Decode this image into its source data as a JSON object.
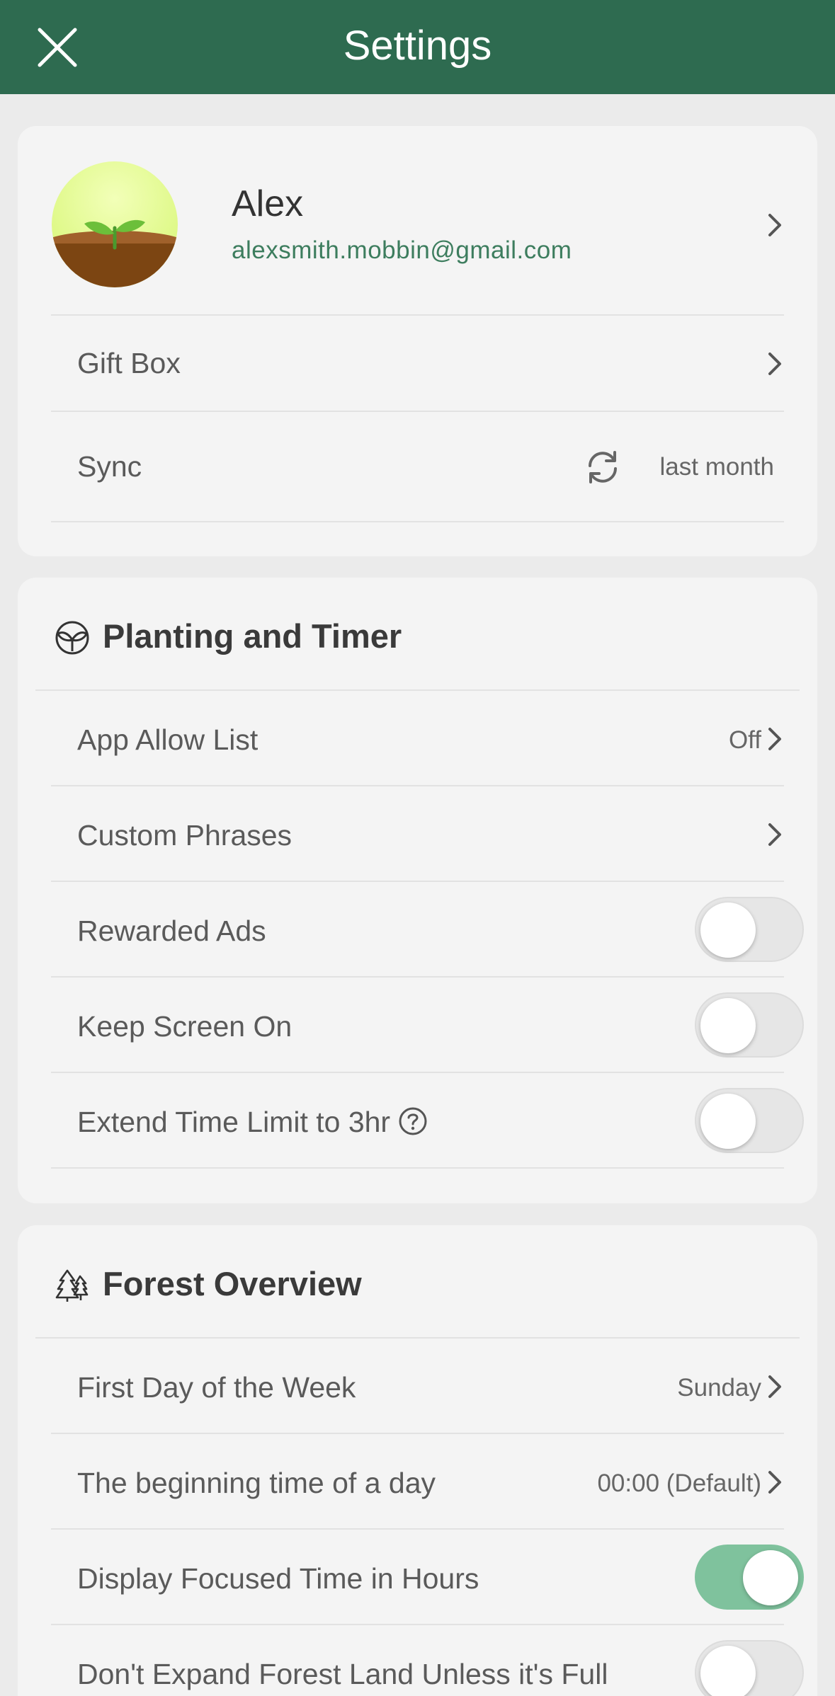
{
  "header": {
    "title": "Settings",
    "background": "#2e6b50"
  },
  "profile": {
    "name": "Alex",
    "email": "alexsmith.mobbin@gmail.com",
    "avatar_icon": "sprout-icon"
  },
  "account_rows": [
    {
      "label": "Gift Box"
    },
    {
      "label": "Sync",
      "value": "last month"
    }
  ],
  "planting": {
    "title": "Planting and Timer",
    "rows": [
      {
        "label": "App Allow List",
        "value": "Off"
      },
      {
        "label": "Custom Phrases"
      },
      {
        "label": "Rewarded Ads",
        "toggle": false
      },
      {
        "label": "Keep Screen On",
        "toggle": false
      },
      {
        "label": "Extend Time Limit to 3hr",
        "toggle": false
      }
    ]
  },
  "forest": {
    "title": "Forest Overview",
    "rows": [
      {
        "label": "First Day of the Week",
        "value": "Sunday"
      },
      {
        "label": "The beginning time of a day",
        "value": "00:00 (Default)"
      },
      {
        "label": "Display Focused Time in Hours",
        "toggle": true
      },
      {
        "label": "Don't Expand Forest Land Unless it's Full",
        "toggle": false
      }
    ]
  },
  "colors": {
    "accent": "#2e6b50",
    "email": "#3d7d5e",
    "toggle_on": "#7fc29d"
  }
}
